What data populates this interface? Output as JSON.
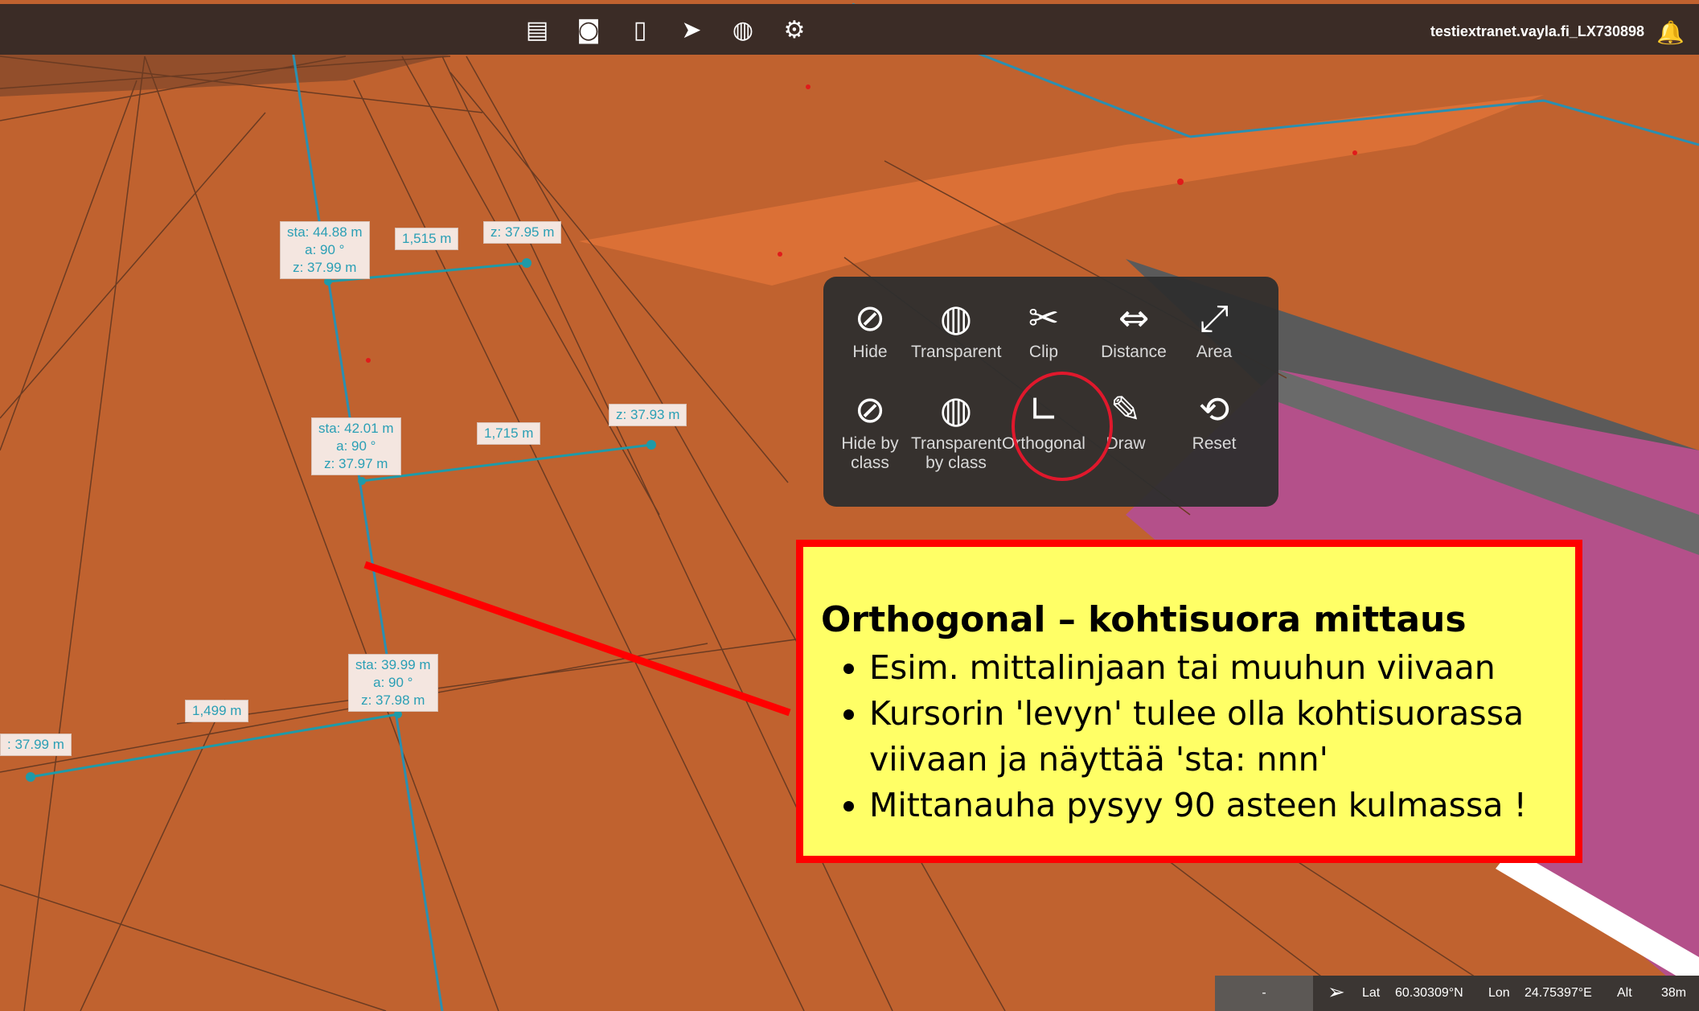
{
  "toolbar": {
    "icons": [
      "list-icon",
      "camera-icon",
      "map-icon",
      "location-arrow-icon",
      "globe-icon",
      "settings-icon"
    ],
    "user": "testiextranet.vayla.fi_LX730898"
  },
  "measurements": {
    "top": {
      "sta": "sta: 44.88 m",
      "a": "a: 90 °",
      "z": "z: 37.99 m",
      "distance": "1,515 m",
      "end_z": "z: 37.95 m"
    },
    "middle": {
      "sta": "sta: 42.01 m",
      "a": "a: 90 °",
      "z": "z: 37.97 m",
      "distance": "1,715 m",
      "end_z": "z: 37.93 m"
    },
    "bottom": {
      "sta": "sta: 39.99 m",
      "a": "a: 90 °",
      "z": "z: 37.98 m",
      "distance": "1,499 m",
      "end_z": ": 37.99 m"
    }
  },
  "tools": {
    "hide": "Hide",
    "transparent": "Transparent",
    "clip": "Clip",
    "distance": "Distance",
    "area": "Area",
    "hide_by_class_1": "Hide by",
    "hide_by_class_2": "class",
    "transparent_by_class_1": "Transparent",
    "transparent_by_class_2": "by class",
    "orthogonal": "Orthogonal",
    "draw": "Draw",
    "reset": "Reset"
  },
  "note": {
    "title": "Orthogonal  – kohtisuora mittaus",
    "bullets": [
      "Esim. mittalinjaan tai muuhun viivaan",
      "Kursorin 'levyn' tulee olla kohtisuorassa viivaan ja näyttää 'sta: nnn'",
      "Mittanauha pysyy 90 asteen kulmassa !"
    ]
  },
  "status": {
    "dash": "-",
    "lat_label": "Lat",
    "lat": "60.30309°N",
    "lon_label": "Lon",
    "lon": "24.75397°E",
    "alt_label": "Alt",
    "alt": "38m"
  }
}
